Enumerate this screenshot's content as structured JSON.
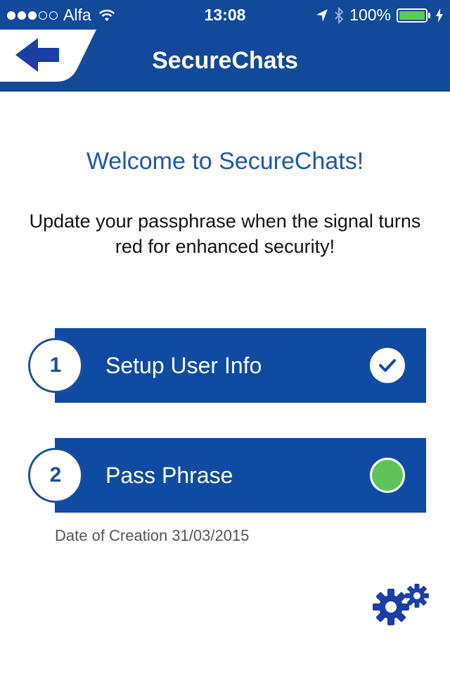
{
  "status_bar": {
    "carrier": "Alfa",
    "time": "13:08",
    "battery_percent": "100%",
    "battery_level": 1.0,
    "signal_bars_filled": 3,
    "signal_bars_total": 5
  },
  "nav": {
    "title": "SecureChats"
  },
  "welcome": {
    "title": "Welcome to SecureChats!",
    "description": "Update your passphrase when the signal turns red for enhanced security!"
  },
  "steps": [
    {
      "number": "1",
      "label": "Setup User Info",
      "status": "completed"
    },
    {
      "number": "2",
      "label": "Pass Phrase",
      "status": "green"
    }
  ],
  "creation": {
    "text": "Date of Creation 31/03/2015"
  },
  "colors": {
    "primary": "#13499a",
    "title_blue": "#1c59a9",
    "signal_green": "#5ec45a",
    "battery_green": "#5ccc4f"
  },
  "icons": {
    "back": "back-arrow-icon",
    "wifi": "wifi-icon",
    "location": "location-arrow-icon",
    "bluetooth": "bluetooth-icon",
    "battery": "battery-icon",
    "charging": "charging-bolt-icon",
    "check": "checkmark-icon",
    "settings": "gears-icon"
  }
}
